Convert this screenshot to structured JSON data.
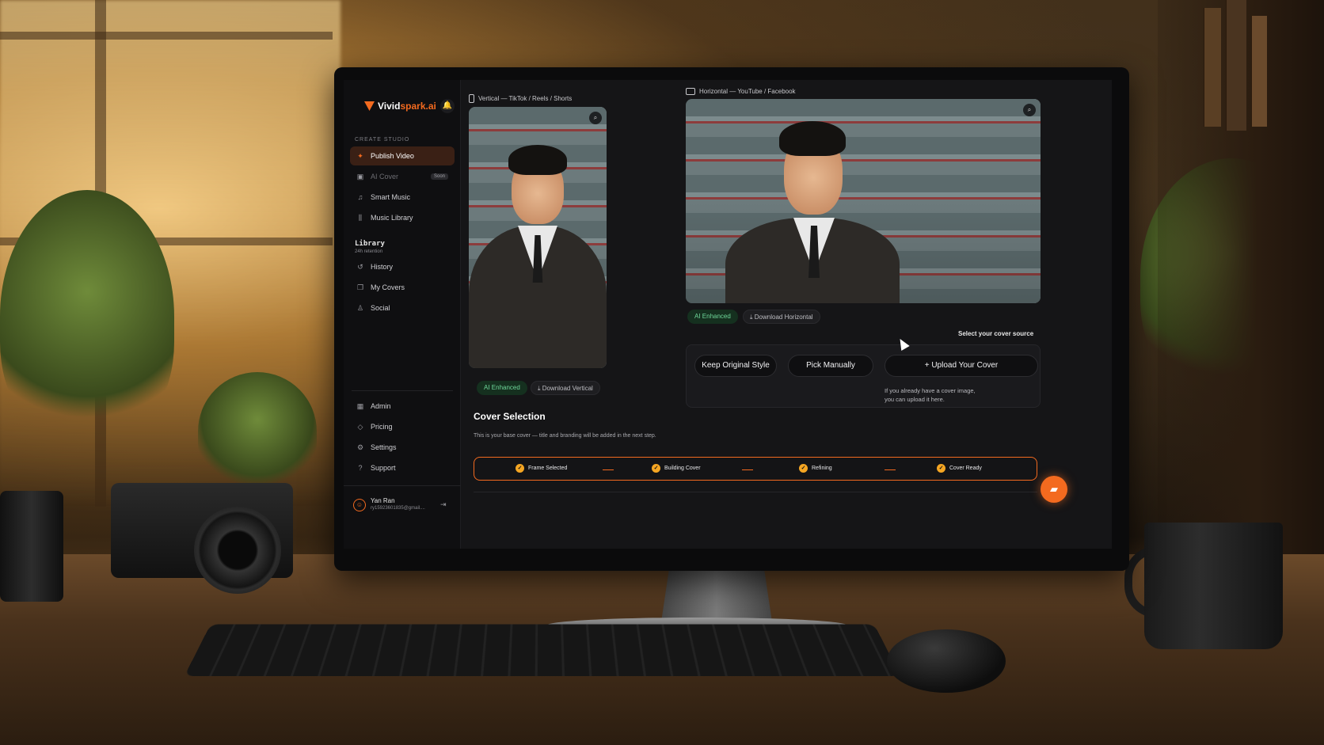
{
  "app": {
    "brand_prefix": "Vivid",
    "brand_suffix": "spark.ai"
  },
  "sidebar": {
    "section_create": "CREATE STUDIO",
    "items_top": [
      {
        "label": "Publish Video",
        "icon": "sparkle-icon",
        "active": true
      },
      {
        "label": "AI Cover",
        "icon": "image-icon",
        "badge": "Soon"
      },
      {
        "label": "Smart Music",
        "icon": "music-note-icon"
      },
      {
        "label": "Music Library",
        "icon": "library-icon"
      }
    ],
    "library_title": "Library",
    "library_sub": "24h retention",
    "items_library": [
      {
        "label": "History",
        "icon": "history-icon"
      },
      {
        "label": "My Covers",
        "icon": "covers-icon"
      },
      {
        "label": "Social",
        "icon": "people-icon"
      }
    ],
    "items_bottom": [
      {
        "label": "Admin",
        "icon": "grid-icon"
      },
      {
        "label": "Pricing",
        "icon": "tag-icon"
      },
      {
        "label": "Settings",
        "icon": "gear-icon"
      },
      {
        "label": "Support",
        "icon": "help-icon"
      }
    ],
    "user": {
      "name": "Yan Ran",
      "email": "ry15923601835@gmail...."
    }
  },
  "main": {
    "vertical_label": "Vertical — TikTok / Reels / Shorts",
    "horizontal_label": "Horizontal — YouTube / Facebook",
    "vertical_badge": "AI Enhanced",
    "vertical_download": "Download Vertical",
    "horizontal_badge": "AI Enhanced",
    "horizontal_download": "Download Horizontal",
    "source_label": "Select your cover source",
    "buttons": {
      "keep": "Keep Original Style",
      "pick": "Pick Manually",
      "upload": "+ Upload Your Cover"
    },
    "upload_hint_line1": "If you already have a cover image,",
    "upload_hint_line2": "you can upload it here.",
    "cover_title": "Cover Selection",
    "cover_desc": "This is your base cover — title and branding will be added in the next step.",
    "steps": [
      {
        "label": "Frame Selected"
      },
      {
        "label": "Building Cover"
      },
      {
        "label": "Refining"
      },
      {
        "label": "Cover Ready"
      }
    ]
  },
  "colors": {
    "accent": "#f36a1f",
    "success": "#6fd89a",
    "step_check": "#f5a623"
  }
}
